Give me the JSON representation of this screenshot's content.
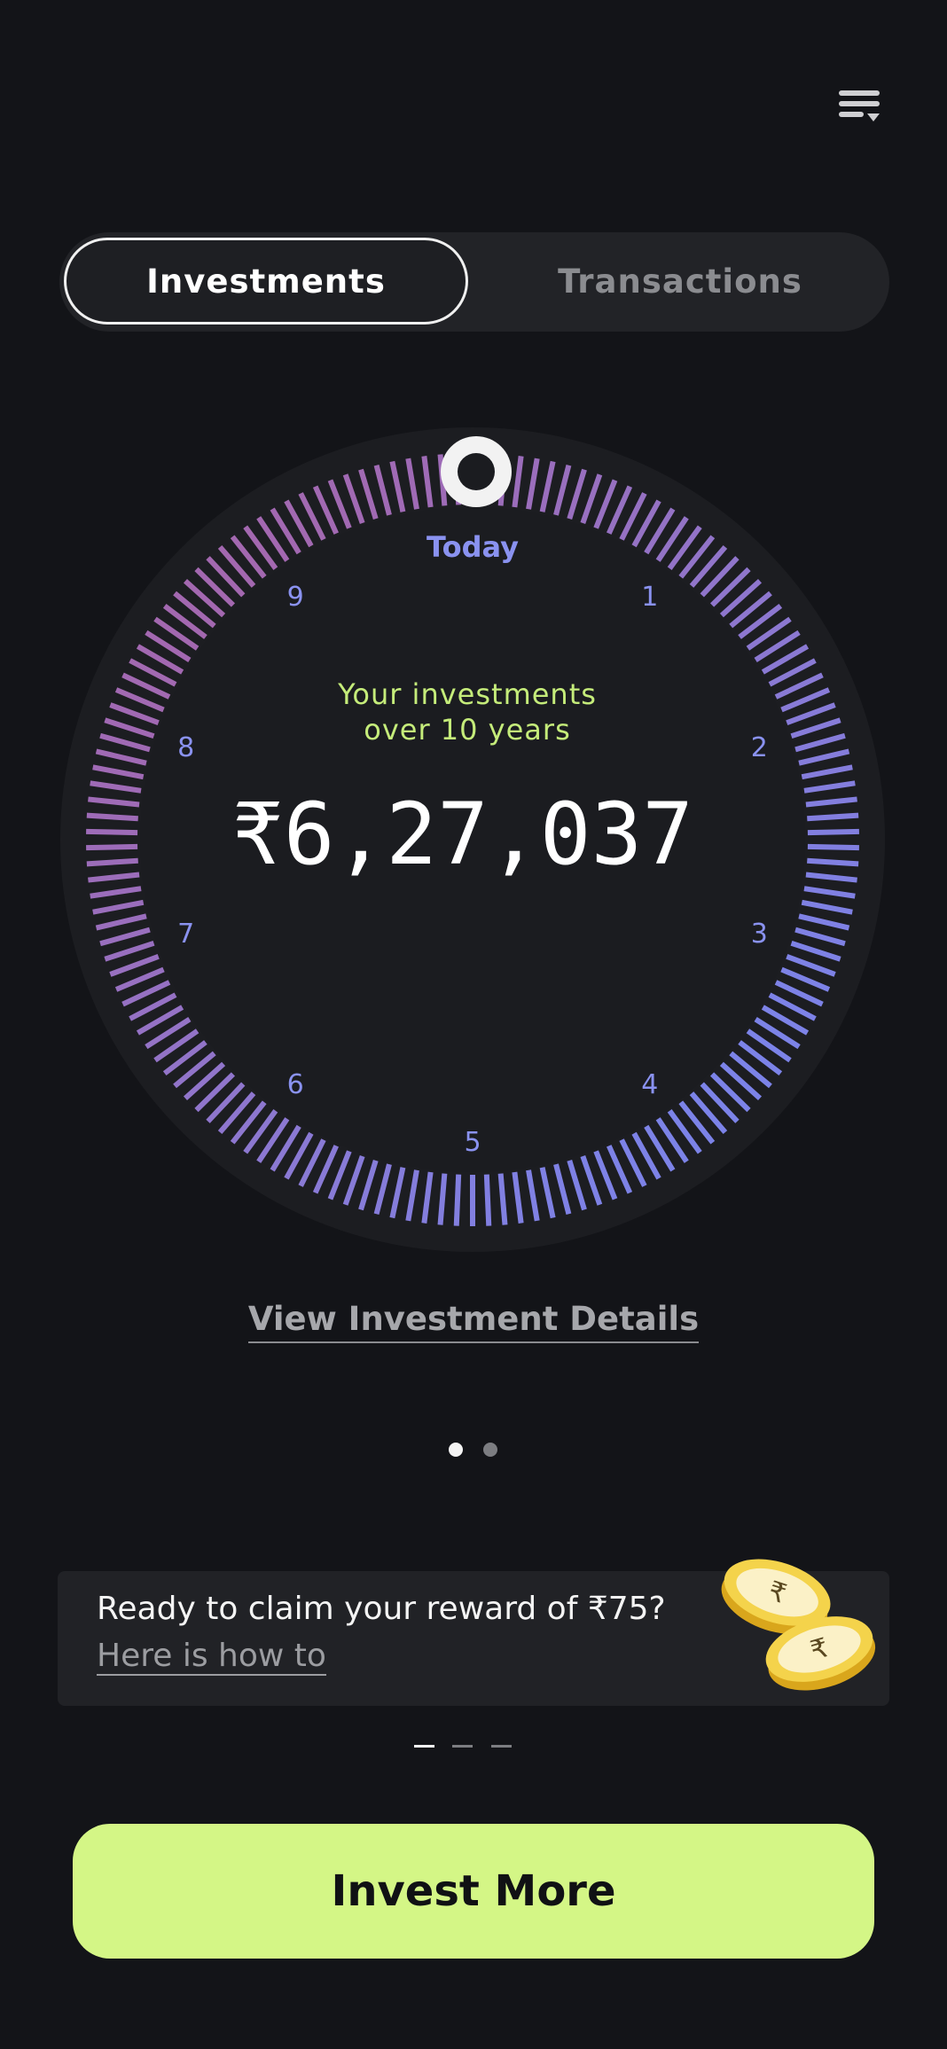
{
  "header": {
    "menu_icon": "filter-menu-icon"
  },
  "tabs": [
    {
      "label": "Investments",
      "active": true
    },
    {
      "label": "Transactions",
      "active": false
    }
  ],
  "dial": {
    "today_label": "Today",
    "caption_line1": "Your investments",
    "caption_line2": "over 10 years",
    "amount": "₹6,27,037",
    "year_marks": [
      "1",
      "2",
      "3",
      "4",
      "5",
      "6",
      "7",
      "8",
      "9"
    ],
    "gradient_colors": {
      "start": "#a06ab4",
      "end": "#7c83e8"
    },
    "caption_color": "#c5ec7a",
    "marker_color": "#8a92f0"
  },
  "details_link": "View Investment Details",
  "pager": {
    "count": 2,
    "active": 0
  },
  "reward": {
    "title": "Ready to claim your reward of ₹75?",
    "link": "Here is how to",
    "image_icon": "gold-coins-icon"
  },
  "carousel": {
    "count": 3,
    "active": 0
  },
  "cta": {
    "label": "Invest More",
    "color": "#d4f686"
  }
}
